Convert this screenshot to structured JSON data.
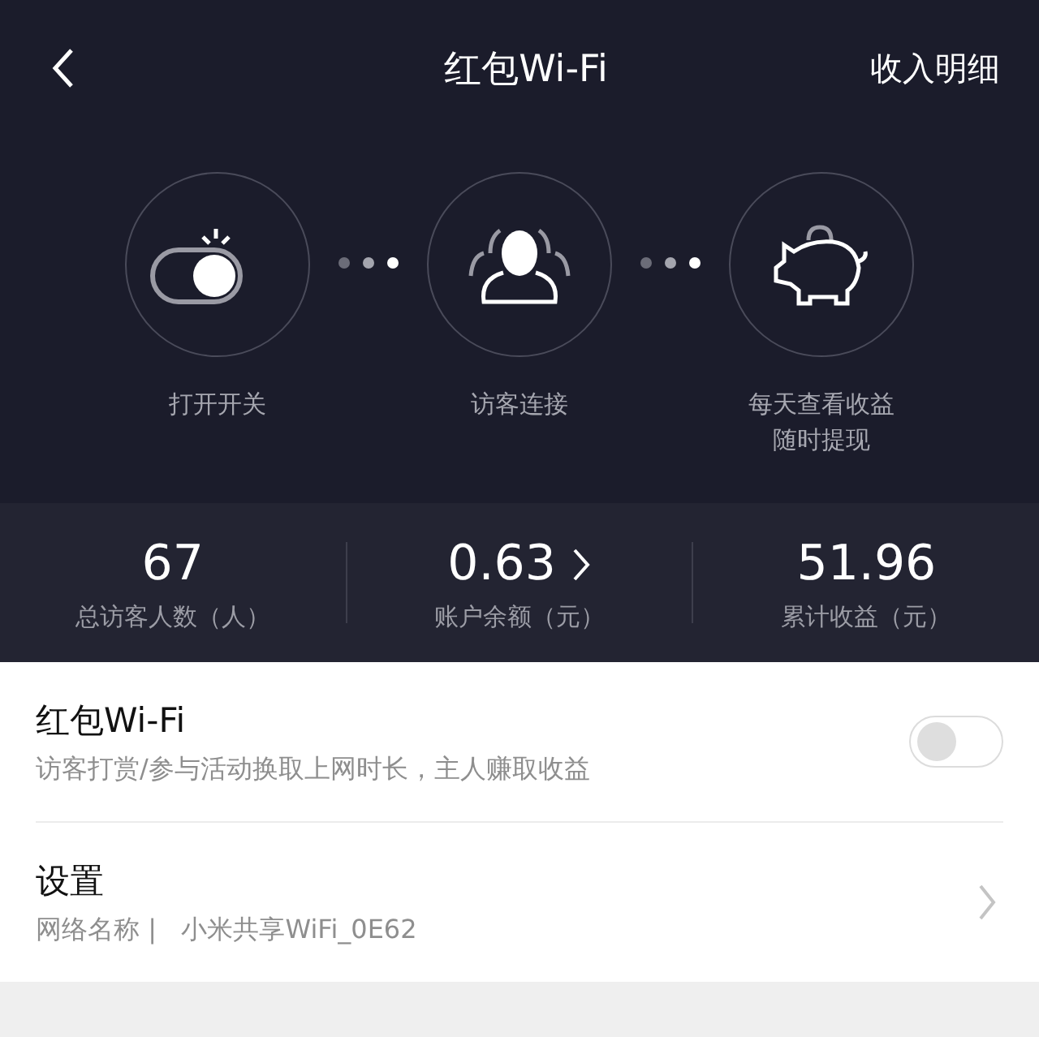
{
  "nav": {
    "title": "红包Wi-Fi",
    "action": "收入明细"
  },
  "steps": [
    {
      "kind": "switch",
      "lines": [
        "打开开关"
      ]
    },
    {
      "kind": "visitor",
      "lines": [
        "访客连接"
      ]
    },
    {
      "kind": "piggy",
      "lines": [
        "每天查看收益",
        "随时提现"
      ]
    }
  ],
  "stats": [
    {
      "value": "67",
      "label": "总访客人数（人）",
      "link": false
    },
    {
      "value": "0.63",
      "label": "账户余额（元）",
      "link": true
    },
    {
      "value": "51.96",
      "label": "累计收益（元）",
      "link": false
    }
  ],
  "settings": [
    {
      "kind": "toggle",
      "title": "红包Wi-Fi",
      "subtitle": "访客打赏/参与活动换取上网时长，主人赚取收益",
      "on": false
    },
    {
      "kind": "link",
      "title": "设置",
      "subtitle": "网络名称 |   小米共享WiFi_0E62"
    }
  ]
}
